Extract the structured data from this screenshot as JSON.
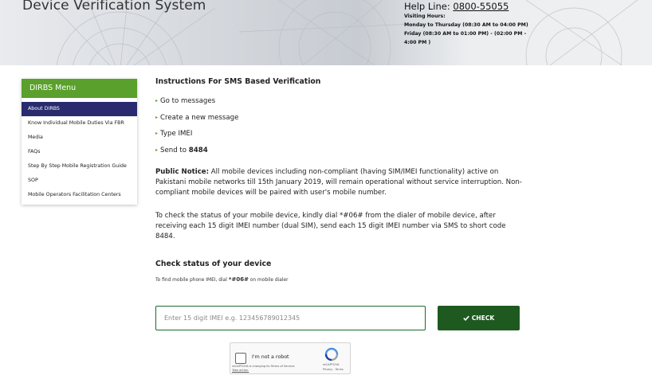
{
  "header": {
    "site_title": "Device Verification System",
    "helpline_label": "Help Line:",
    "helpline_number": "0800-55055",
    "visiting_hours_label": "Visiting Hours:",
    "hours_line1": "Monday to Thursday (08:30 AM to 04:00 PM)",
    "hours_line2": "Friday (08:30 AM to 01:00 PM) - (02:00 PM -",
    "hours_line3": "4:00 PM )"
  },
  "sidebar": {
    "title": "DIRBS Menu",
    "items": [
      {
        "label": "About DIRBS"
      },
      {
        "label": "Know Individual Mobile Duties Via FBR"
      },
      {
        "label": "Media"
      },
      {
        "label": "FAQs"
      },
      {
        "label": "Step By Step Mobile Registration Guide"
      },
      {
        "label": "SOP"
      },
      {
        "label": "Mobile Operators Facilitation Centers"
      }
    ]
  },
  "main": {
    "instructions_title": "Instructions For SMS Based Verification",
    "steps": [
      {
        "text": "Go to messages"
      },
      {
        "text": "Create a new message"
      },
      {
        "text": "Type IMEI"
      },
      {
        "text": "Send to ",
        "bold": "8484"
      }
    ],
    "notice_label": "Public Notice:",
    "notice_text": " All mobile devices including non-compliant (having SIM/IMEI functionality) active on Pakistani mobile networks till 15th January 2019, will remain operational without service interruption. Non-compliant mobile devices will be paired with user's mobile number.",
    "status_text": "To check the status of your mobile device, kindly dial *#06# from the dialer of mobile device, after receiving each 15 digit IMEI number (dual SIM), send each 15 digit IMEI number via SMS to short code 8484.",
    "check_title": "Check status of your device",
    "hint_prefix": "To find mobile phone IMEI, dial ",
    "hint_code": "*#06#",
    "hint_suffix": " on mobile dialer"
  },
  "form": {
    "imei_placeholder": "Enter 15 digit IMEI e.g. 123456789012345",
    "imei_value": "",
    "check_icon": "check-icon",
    "check_label": "CHECK"
  },
  "captcha": {
    "label": "I'm not a robot",
    "notice_line1": "reCAPTCHA is changing its Terms of Service.",
    "notice_link": "Take action.",
    "brand": "reCAPTCHA",
    "links": "Privacy - Terms"
  },
  "colors": {
    "menu_green": "#5aa02c",
    "active_navy": "#2a2a6e",
    "button_green": "#1e5a20",
    "input_border": "#1b6a2b"
  }
}
